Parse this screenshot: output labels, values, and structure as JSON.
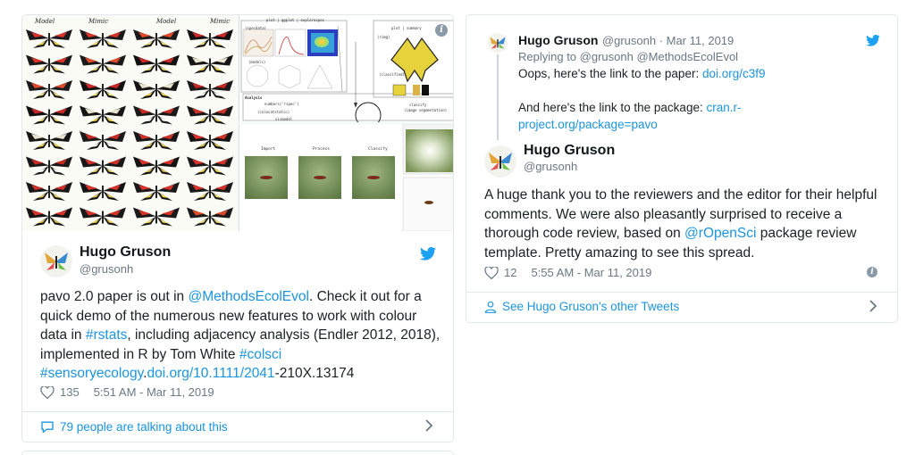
{
  "left_tweet": {
    "media": {
      "col_heads": [
        "Model",
        "Mimic",
        "Model",
        "Mimic"
      ],
      "diagram_labels": [
        "plot | ggplot | explorespec",
        "plot | summary",
        "(specdata)",
        "(rimg)",
        "(models)",
        "(classified)",
        "Analysis",
        "numbers('rspec')",
        "(colocatstatic)",
        "classify",
        "(image segmentation)",
        "vismodel"
      ],
      "steps": [
        "Import",
        "Process",
        "Classify",
        "Analyse"
      ]
    },
    "author": {
      "name": "Hugo Gruson",
      "handle": "@grusonh"
    },
    "text_parts": {
      "p1": "pavo 2.0 paper is out in ",
      "mention": "@MethodsEcolEvol",
      "p2": ". Check it out for a quick demo of the numerous new features to work with colour data in ",
      "hashtag1": "#rstats",
      "p3": ", including adjacency analysis (Endler 2012, 2018), implemented in R by Tom White ",
      "hashtag2": "#colsci",
      "hashtag3": "#sensoryecology",
      "p4": ".",
      "link": "doi.org/10.1111/2041",
      "p5": "-210X.13174"
    },
    "likes": "135",
    "timestamp": "5:51 AM - Mar 11, 2019",
    "talking": "79 people are talking about this"
  },
  "right_tweet": {
    "reply": {
      "name": "Hugo Gruson",
      "handle_date": "@grusonh · Mar 11, 2019",
      "replying_to": "Replying to @grusonh @MethodsEcolEvol",
      "line1": "Oops, here's the link to the paper: ",
      "link1": "doi.org/c3f9",
      "line2": "And here's the link to the package: ",
      "link2a": "cran.r-",
      "link2b": "project.org/package=pavo"
    },
    "author": {
      "name": "Hugo Gruson",
      "handle": "@grusonh"
    },
    "text_parts": {
      "p1": "A huge thank you to the reviewers and the editor for their helpful comments. We were also pleasantly surprised to receive a thorough code review, based on ",
      "mention": "@rOpenSci",
      "p2": " package review template. Pretty amazing to see this spread."
    },
    "likes": "12",
    "timestamp": "5:55 AM - Mar 11, 2019",
    "other_tweets": "See Hugo Gruson's other Tweets"
  },
  "colors": {
    "twitter_blue": "#1da1f2",
    "link": "#1b95e0",
    "muted": "#697882",
    "border": "#e1e8ed"
  },
  "icons": [
    "twitter-bird-icon",
    "heart-icon",
    "info-icon",
    "comment-bubble-icon",
    "user-icon",
    "chevron-right-icon"
  ]
}
